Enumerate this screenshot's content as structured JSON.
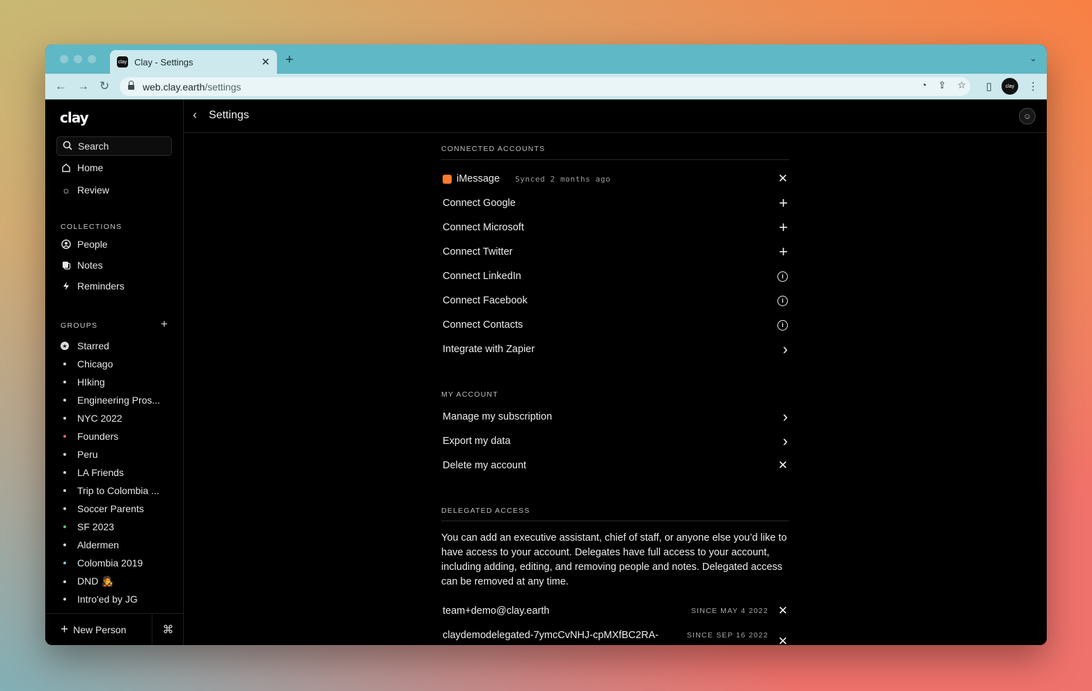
{
  "browser": {
    "tab_title": "Clay - Settings",
    "favicon_text": "clay",
    "url_host": "web.clay.earth",
    "url_path": "/settings",
    "profile_text": "clay"
  },
  "sidebar": {
    "logo": "clay",
    "search_label": "Search",
    "nav": [
      {
        "label": "Home",
        "icon": "home-icon"
      },
      {
        "label": "Review",
        "icon": "sun-icon"
      }
    ],
    "collections_label": "COLLECTIONS",
    "collections": [
      {
        "label": "People",
        "icon": "person-circle-icon"
      },
      {
        "label": "Notes",
        "icon": "notes-icon"
      },
      {
        "label": "Reminders",
        "icon": "bolt-icon"
      }
    ],
    "groups_label": "GROUPS",
    "groups": [
      {
        "label": "Starred",
        "dot_color": "#dddddd"
      },
      {
        "label": "Chicago",
        "dot_color": "#cfd8d8"
      },
      {
        "label": "HIking",
        "dot_color": "#cfd8d8"
      },
      {
        "label": "Engineering Pros...",
        "dot_color": "#cfd8d8"
      },
      {
        "label": "NYC 2022",
        "dot_color": "#cfd8d8"
      },
      {
        "label": "Founders",
        "dot_color": "#e06a6a"
      },
      {
        "label": "Peru",
        "dot_color": "#cfd8d8"
      },
      {
        "label": "LA Friends",
        "dot_color": "#cfd8d8"
      },
      {
        "label": "Trip to Colombia ...",
        "dot_color": "#cfd8d8"
      },
      {
        "label": "Soccer Parents",
        "dot_color": "#cfd8d8"
      },
      {
        "label": "SF 2023",
        "dot_color": "#5fbf7a"
      },
      {
        "label": "Aldermen",
        "dot_color": "#cfd8d8"
      },
      {
        "label": "Colombia 2019",
        "dot_color": "#7fc7c9"
      },
      {
        "label": "DND 🧑‍🎤",
        "dot_color": "#cfd8d8"
      },
      {
        "label": "Intro'ed by JG",
        "dot_color": "#cfd8d8"
      }
    ],
    "new_person": "New Person",
    "cmd_symbol": "⌘"
  },
  "header": {
    "title": "Settings"
  },
  "connected_accounts": {
    "heading": "CONNECTED ACCOUNTS",
    "imessage": {
      "label": "iMessage",
      "meta": "Synced 2 months ago"
    },
    "items": [
      {
        "label": "Connect Google",
        "action": "+"
      },
      {
        "label": "Connect Microsoft",
        "action": "+"
      },
      {
        "label": "Connect Twitter",
        "action": "+"
      },
      {
        "label": "Connect LinkedIn",
        "action": "i"
      },
      {
        "label": "Connect Facebook",
        "action": "i"
      },
      {
        "label": "Connect Contacts",
        "action": "i"
      },
      {
        "label": "Integrate with Zapier",
        "action": "›"
      }
    ]
  },
  "my_account": {
    "heading": "MY ACCOUNT",
    "items": [
      {
        "label": "Manage my subscription",
        "action": "›"
      },
      {
        "label": "Export my data",
        "action": "›"
      },
      {
        "label": "Delete my account",
        "action": "✕"
      }
    ]
  },
  "delegated_access": {
    "heading": "DELEGATED ACCESS",
    "description": "You can add an executive assistant, chief of staff, or anyone else you’d like to have access to your account. Delegates have full access to your account, including adding, editing, and removing people and notes. Delegated access can be removed at any time.",
    "delegates": [
      {
        "email": "team+demo@clay.earth",
        "since": "SINCE MAY 4 2022"
      },
      {
        "email": "claydemodelegated-7ymcCvNHJ-cpMXfBC2RA-",
        "since": "SINCE SEP 16 2022"
      }
    ]
  }
}
